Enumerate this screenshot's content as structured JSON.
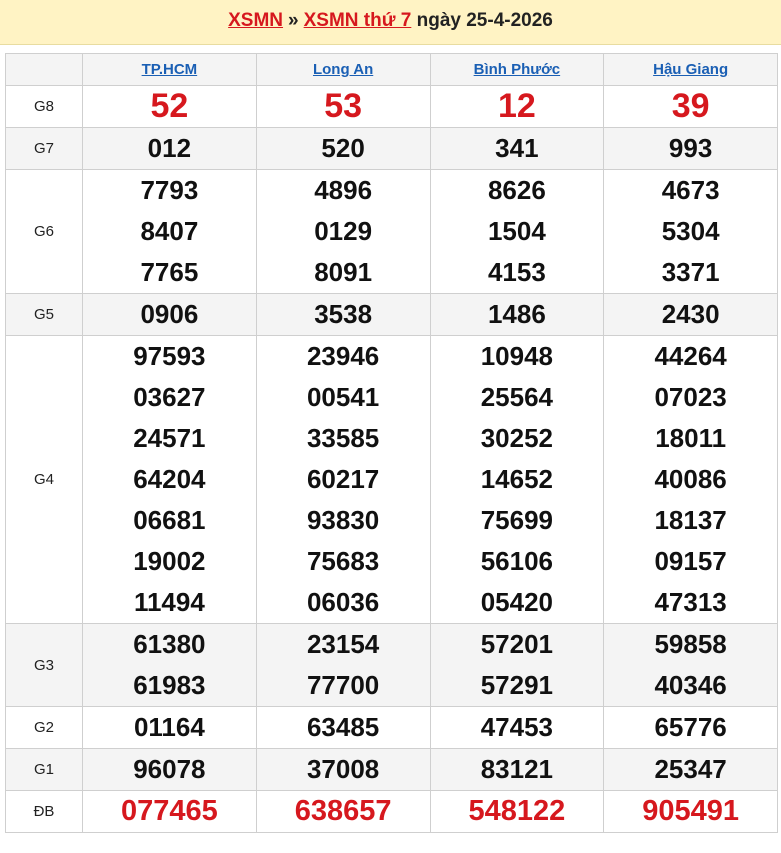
{
  "header": {
    "link1": "XSMN",
    "separator": "»",
    "link2": "XSMN thứ 7",
    "suffix": "ngày 25-4-2026"
  },
  "provinces": [
    "TP.HCM",
    "Long An",
    "Bình Phước",
    "Hậu Giang"
  ],
  "prizes": [
    {
      "label": "G8",
      "style": "g8",
      "values": [
        [
          "52"
        ],
        [
          "53"
        ],
        [
          "12"
        ],
        [
          "39"
        ]
      ]
    },
    {
      "label": "G7",
      "style": "shade",
      "values": [
        [
          "012"
        ],
        [
          "520"
        ],
        [
          "341"
        ],
        [
          "993"
        ]
      ]
    },
    {
      "label": "G6",
      "style": "",
      "values": [
        [
          "7793",
          "8407",
          "7765"
        ],
        [
          "4896",
          "0129",
          "8091"
        ],
        [
          "8626",
          "1504",
          "4153"
        ],
        [
          "4673",
          "5304",
          "3371"
        ]
      ]
    },
    {
      "label": "G5",
      "style": "shade",
      "values": [
        [
          "0906"
        ],
        [
          "3538"
        ],
        [
          "1486"
        ],
        [
          "2430"
        ]
      ]
    },
    {
      "label": "G4",
      "style": "",
      "values": [
        [
          "97593",
          "03627",
          "24571",
          "64204",
          "06681",
          "19002",
          "11494"
        ],
        [
          "23946",
          "00541",
          "33585",
          "60217",
          "93830",
          "75683",
          "06036"
        ],
        [
          "10948",
          "25564",
          "30252",
          "14652",
          "75699",
          "56106",
          "05420"
        ],
        [
          "44264",
          "07023",
          "18011",
          "40086",
          "18137",
          "09157",
          "47313"
        ]
      ]
    },
    {
      "label": "G3",
      "style": "shade",
      "values": [
        [
          "61380",
          "61983"
        ],
        [
          "23154",
          "77700"
        ],
        [
          "57201",
          "57291"
        ],
        [
          "59858",
          "40346"
        ]
      ]
    },
    {
      "label": "G2",
      "style": "",
      "values": [
        [
          "01164"
        ],
        [
          "63485"
        ],
        [
          "47453"
        ],
        [
          "65776"
        ]
      ]
    },
    {
      "label": "G1",
      "style": "shade",
      "values": [
        [
          "96078"
        ],
        [
          "37008"
        ],
        [
          "83121"
        ],
        [
          "25347"
        ]
      ]
    },
    {
      "label": "ĐB",
      "style": "db",
      "values": [
        [
          "077465"
        ],
        [
          "638657"
        ],
        [
          "548122"
        ],
        [
          "905491"
        ]
      ]
    }
  ],
  "colors": {
    "accent_red": "#d6181e",
    "link_blue": "#1a5fb4",
    "title_bg": "#fff3c4"
  }
}
